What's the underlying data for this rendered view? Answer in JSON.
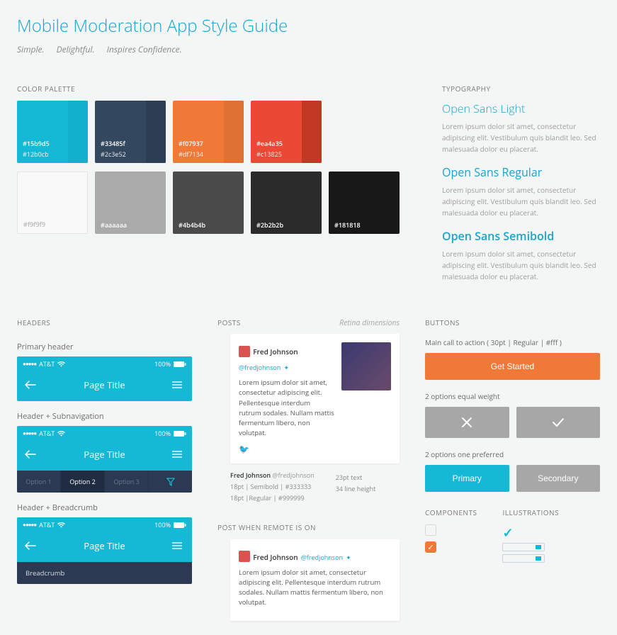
{
  "header": {
    "title": "Mobile Moderation App Style Guide",
    "taglines": [
      "Simple.",
      "Delightful.",
      "Inspires Confidence."
    ]
  },
  "palette": {
    "label": "COLOR PALETTE",
    "row1": [
      {
        "main": "#15b9d5",
        "shade": "#12b0cb"
      },
      {
        "main": "#33485f",
        "shade": "#2c3e52"
      },
      {
        "main": "#f07937",
        "shade": "#df7134"
      },
      {
        "main": "#ea4a35",
        "shade": "#c13825"
      }
    ],
    "row2": [
      {
        "main": "#f9f9f9",
        "shade": ""
      },
      {
        "main": "#aaaaaa",
        "shade": ""
      },
      {
        "main": "#4b4b4b",
        "shade": ""
      },
      {
        "main": "#2b2b2b",
        "shade": ""
      },
      {
        "main": "#181818",
        "shade": ""
      }
    ]
  },
  "typography": {
    "label": "TYPOGRAPHY",
    "samples": [
      {
        "heading": "Open Sans Light",
        "weight": "tw-light"
      },
      {
        "heading": "Open Sans Regular",
        "weight": "tw-regular"
      },
      {
        "heading": "Open Sans Semibold",
        "weight": "tw-semibold"
      }
    ],
    "body": "Lorem ipsum dolor sit amet, consectetur adipiscing elit. Vestibulum quis blandit leo. Sed malesuada dolor eu placerat."
  },
  "headers": {
    "label": "HEADERS",
    "sub1": "Primary header",
    "sub2": "Header + Subnavigation",
    "sub3": "Header + Breadcrumb",
    "carrier": "AT&T",
    "battery": "100%",
    "title": "Page Title",
    "options": [
      "Option 1",
      "Option 2",
      "Option 3"
    ],
    "breadcrumb": "Breadcrumb"
  },
  "posts": {
    "label": "POSTS",
    "note": "Retina dimensions",
    "author": "Fred Johnson",
    "handle": "@fredjohnson",
    "body": "Lorem ipsum dolor sit amet, consectetur adipiscing elit. Pellentesque interdum rutrum sodales. Nullam mattis fermentum libero, non volutpat.",
    "meta": {
      "name": "Fred Johnson",
      "handle": "@fredjohnson",
      "l1": "18pt | Semibold | #333333",
      "l2": "18pt |Regular | #999999",
      "l3": "23pt text",
      "l4": "34 line height"
    },
    "label2": "POST WHEN REMOTE IS ON"
  },
  "buttons": {
    "label": "BUTTONS",
    "cta_desc": "Main call to action ( 30pt | Regular | #fff )",
    "cta_label": "Get Started",
    "pair1_desc": "2 options equal weight",
    "pair2_desc": "2 options one preferred",
    "primary": "Primary",
    "secondary": "Secondary"
  },
  "components": {
    "label": "COMPONENTS",
    "illus_label": "ILLUSTRATIONS"
  }
}
